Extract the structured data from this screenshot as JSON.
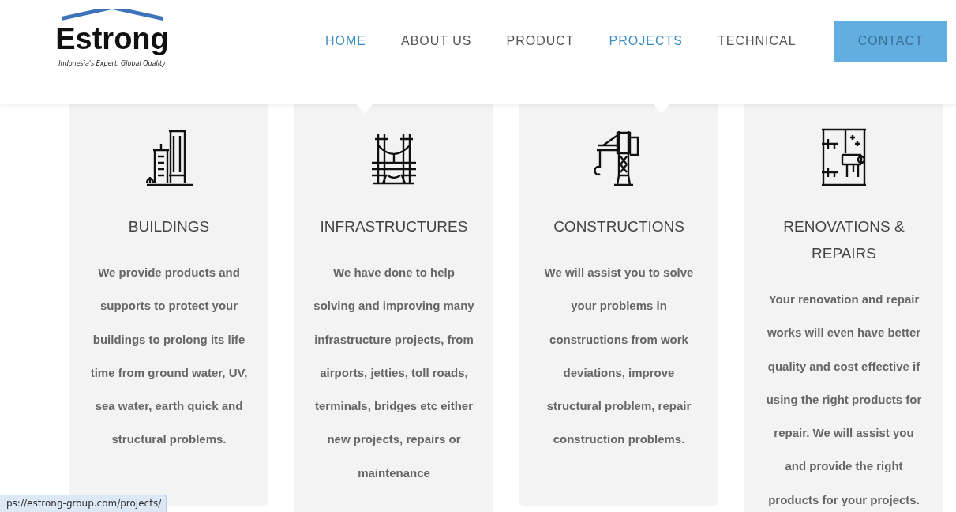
{
  "logo": {
    "name": "Estrong",
    "tagline": "Indonesia's Expert, Global Quality"
  },
  "nav": [
    {
      "label": "HOME",
      "kind": "link",
      "selected": true
    },
    {
      "label": "ABOUT US",
      "kind": "link",
      "selected": false
    },
    {
      "label": "PRODUCT",
      "kind": "link",
      "selected": false
    },
    {
      "label": "PROJECTS",
      "kind": "link",
      "selected": true
    },
    {
      "label": "TECHNICAL",
      "kind": "link",
      "selected": false
    },
    {
      "label": "CONTACT",
      "kind": "button",
      "selected": false
    }
  ],
  "cards": [
    {
      "kind": "buildings",
      "title": "BUILDINGS",
      "text": "We provide products and supports to protect your buildings to prolong its life time from ground water, UV, sea water, earth quick and structural problems."
    },
    {
      "kind": "bridge",
      "title": "INFRASTRUCTURES",
      "text": "We have done to help solving and improving many infrastructure projects, from airports, jetties, toll roads, terminals, bridges etc either new projects, repairs or maintenance"
    },
    {
      "kind": "crane",
      "title": "CONSTRUCTIONS",
      "text": "We will assist you to solve your problems in constructions from work deviations, improve structural problem, repair construction problems."
    },
    {
      "kind": "wall",
      "title": "RENOVATIONS & REPAIRS",
      "text": "Your renovation and repair works will even have better quality and cost effective if using the right products for repair. We will assist you and provide the right products for your projects."
    }
  ],
  "status_url": "ps://estrong-group.com/projects/"
}
